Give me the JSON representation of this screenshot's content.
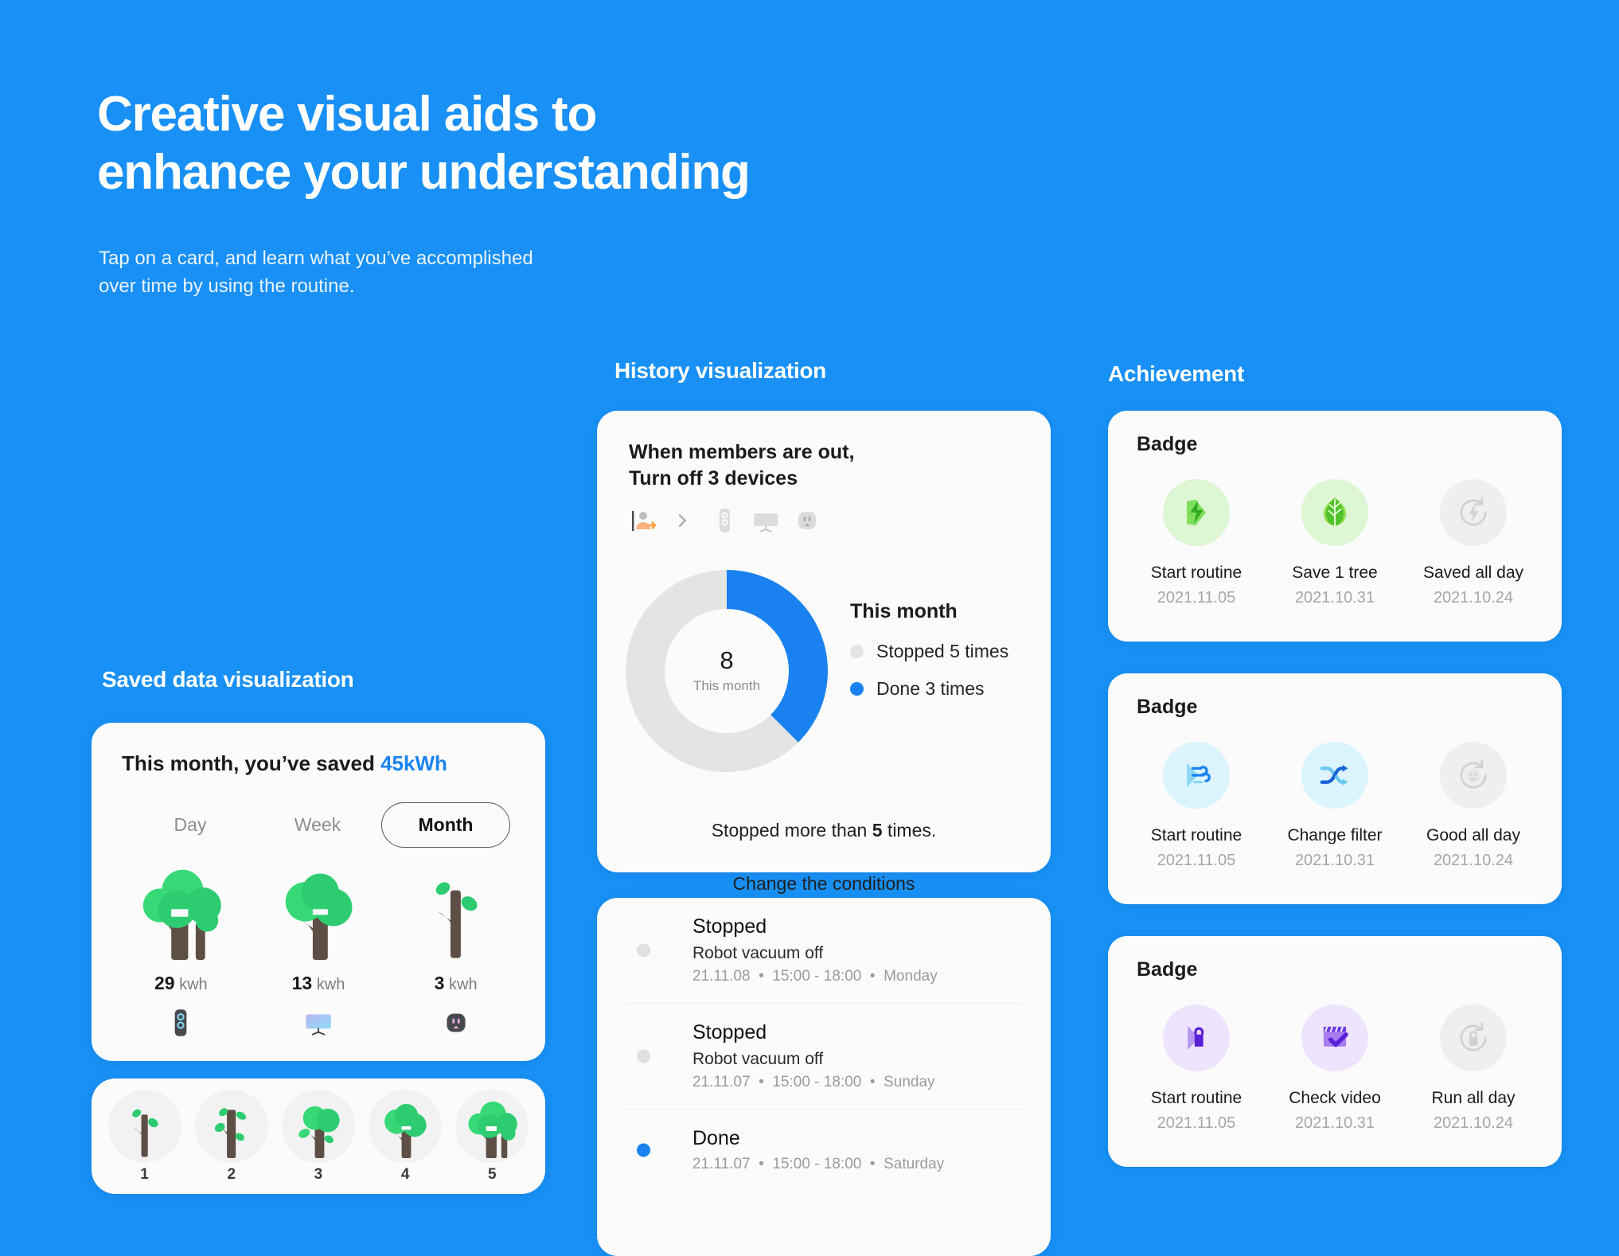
{
  "hero": {
    "title": "Creative visual aids to\nenhance your understanding",
    "subtitle": "Tap on a card, and learn what you’ve accomplished\nover time by using the routine."
  },
  "colors": {
    "background": "#1890f5",
    "accent_blue": "#1a82f0",
    "card_bg": "#fbfbfb",
    "track_grey": "#e4e4e4",
    "tree_green": "#2ecc71",
    "trunk_brown": "#5d4f45"
  },
  "sections": {
    "saved": "Saved data visualization",
    "history": "History visualization",
    "achievement": "Achievement"
  },
  "saved_card": {
    "headline_prefix": "This month, you’ve saved ",
    "headline_value": "45kWh",
    "tabs": [
      {
        "label": "Day",
        "active": false
      },
      {
        "label": "Week",
        "active": false
      },
      {
        "label": "Month",
        "active": true
      }
    ],
    "devices": [
      {
        "value": "29",
        "unit": "kwh",
        "icon": "remote-control-icon",
        "tree_stage": 5
      },
      {
        "value": "13",
        "unit": "kwh",
        "icon": "tv-icon",
        "tree_stage": 4
      },
      {
        "value": "3",
        "unit": "kwh",
        "icon": "power-outlet-icon",
        "tree_stage": 1
      }
    ]
  },
  "tree_stages": [
    {
      "num": "1"
    },
    {
      "num": "2"
    },
    {
      "num": "3"
    },
    {
      "num": "4"
    },
    {
      "num": "5"
    }
  ],
  "history_card": {
    "title": "When members are out,\nTurn off 3 devices",
    "flow_icons": [
      "member-leaving-icon",
      "chevron-right-icon",
      "remote-control-icon",
      "tv-icon",
      "power-outlet-icon"
    ],
    "donut_center_value": "8",
    "donut_center_caption": "This month",
    "legend_title": "This month",
    "legend": [
      {
        "label": "Stopped 5 times",
        "color": "#e4e4e4",
        "value": 5
      },
      {
        "label": "Done 3 times",
        "color": "#1a82f0",
        "value": 3
      }
    ],
    "footer_line1_prefix": "Stopped more than ",
    "footer_line1_bold": "5",
    "footer_line1_suffix": " times.",
    "footer_line2": "Change the conditions"
  },
  "chart_data": {
    "type": "pie",
    "title": "This month",
    "center_label": "8",
    "center_sublabel": "This month",
    "categories": [
      "Stopped",
      "Done"
    ],
    "values": [
      5,
      3
    ],
    "total": 8,
    "colors": [
      "#e4e4e4",
      "#1a82f0"
    ],
    "legend_entries": [
      "Stopped 5 times",
      "Done 3 times"
    ],
    "legend_position": "right",
    "donut": true,
    "inner_radius_ratio": 0.61,
    "start_angle_deg": 0,
    "grid": false
  },
  "log_card": {
    "items": [
      {
        "status": "Stopped",
        "desc": "Robot vacuum off",
        "date": "21.11.08",
        "time": "15:00 - 18:00",
        "day": "Monday",
        "dot_color": "#e0e0e0"
      },
      {
        "status": "Stopped",
        "desc": "Robot vacuum off",
        "date": "21.11.07",
        "time": "15:00 - 18:00",
        "day": "Sunday",
        "dot_color": "#e0e0e0"
      },
      {
        "status": "Done",
        "desc": "",
        "date": "21.11.07",
        "time": "15:00 - 18:00",
        "day": "Saturday",
        "dot_color": "#1a82f0"
      }
    ],
    "separator": "•"
  },
  "badge_cards": [
    {
      "heading": "Badge",
      "items": [
        {
          "label": "Start routine",
          "date": "2021.11.05",
          "icon": "energy-bolt-icon",
          "bubble": "#ddf6d3",
          "tint": "#3ec13a",
          "locked": false
        },
        {
          "label": "Save 1 tree",
          "date": "2021.10.31",
          "icon": "leaf-icon",
          "bubble": "#ddf6d3",
          "tint": "#51c617",
          "locked": false
        },
        {
          "label": "Saved all day",
          "date": "2021.10.24",
          "icon": "refresh-bolt-icon",
          "bubble": "#efefef",
          "tint": "#d2d2d2",
          "locked": true
        }
      ]
    },
    {
      "heading": "Badge",
      "items": [
        {
          "label": "Start routine",
          "date": "2021.11.05",
          "icon": "air-flow-icon",
          "bubble": "#dbf4fd",
          "tint": "#1a82f0",
          "locked": false
        },
        {
          "label": "Change filter",
          "date": "2021.10.31",
          "icon": "shuffle-icon",
          "bubble": "#dbf4fd",
          "tint": "#1a82f0",
          "locked": false
        },
        {
          "label": "Good all day",
          "date": "2021.10.24",
          "icon": "refresh-face-icon",
          "bubble": "#efefef",
          "tint": "#d2d2d2",
          "locked": true
        }
      ]
    },
    {
      "heading": "Badge",
      "items": [
        {
          "label": "Start routine",
          "date": "2021.11.05",
          "icon": "lock-play-icon",
          "bubble": "#eee4fd",
          "tint": "#5b21d6",
          "locked": false
        },
        {
          "label": "Check video",
          "date": "2021.10.31",
          "icon": "clapperboard-check-icon",
          "bubble": "#eee4fd",
          "tint": "#6d3ce0",
          "locked": false
        },
        {
          "label": "Run all day",
          "date": "2021.10.24",
          "icon": "refresh-lock-icon",
          "bubble": "#efefef",
          "tint": "#d2d2d2",
          "locked": true
        }
      ]
    }
  ]
}
